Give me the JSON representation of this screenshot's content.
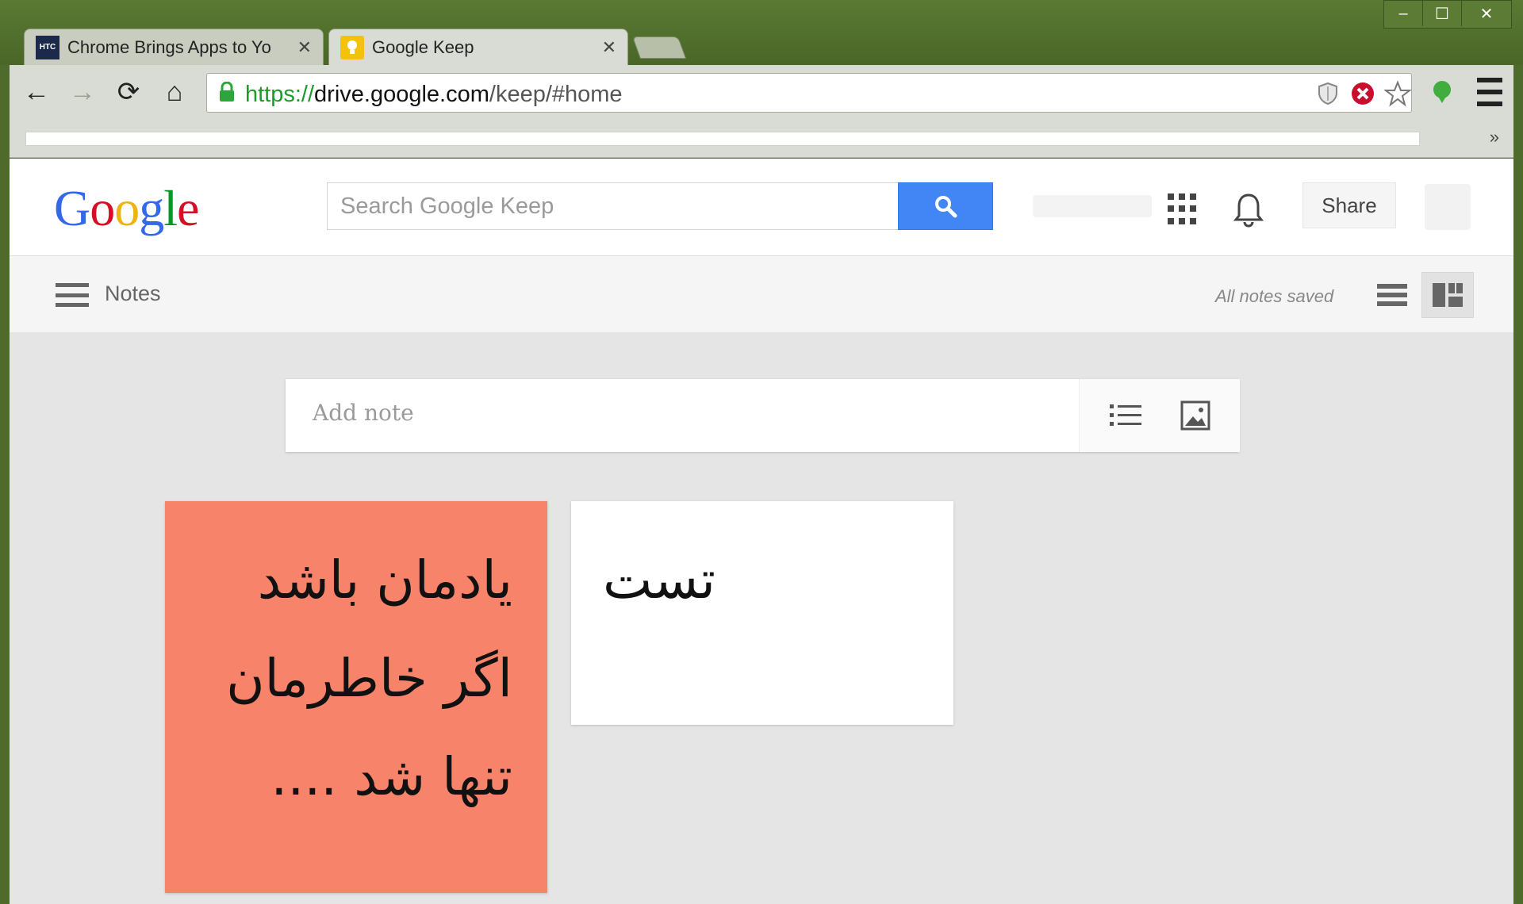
{
  "window": {
    "controls": {
      "minimize": "–",
      "maximize": "☐",
      "close": "✕"
    }
  },
  "tabs": [
    {
      "favicon_text": "HTC",
      "title": "Chrome Brings Apps to Yo",
      "close": "✕",
      "active": false
    },
    {
      "favicon_text": "",
      "title": "Google Keep",
      "close": "✕",
      "active": true
    }
  ],
  "toolbar": {
    "back_icon": "←",
    "forward_icon": "→",
    "reload_icon": "⟳",
    "home_icon": "⌂",
    "url_scheme": "https://",
    "url_host": "drive.google.com",
    "url_path": "/keep/#home",
    "bookmarks_overflow": "»"
  },
  "header": {
    "logo_letters": [
      "G",
      "o",
      "o",
      "g",
      "l",
      "e"
    ],
    "logo_colors": [
      "#3369e8",
      "#d50f25",
      "#eeb211",
      "#3369e8",
      "#009925",
      "#d50f25"
    ],
    "search_placeholder": "Search Google Keep",
    "share_label": "Share"
  },
  "subbar": {
    "section_label": "Notes",
    "status": "All notes saved"
  },
  "composer": {
    "placeholder": "Add note"
  },
  "notes": [
    {
      "color": "#f7846a",
      "text": "یادمان باشد\nاگر خاطرمان\nتنها شد ...."
    },
    {
      "color": "#ffffff",
      "text": "تست"
    }
  ],
  "colors": {
    "frame": "#4e6b2b",
    "accent_blue": "#4285f4",
    "secure_green": "#1d9a2a",
    "note_red": "#f7846a"
  }
}
